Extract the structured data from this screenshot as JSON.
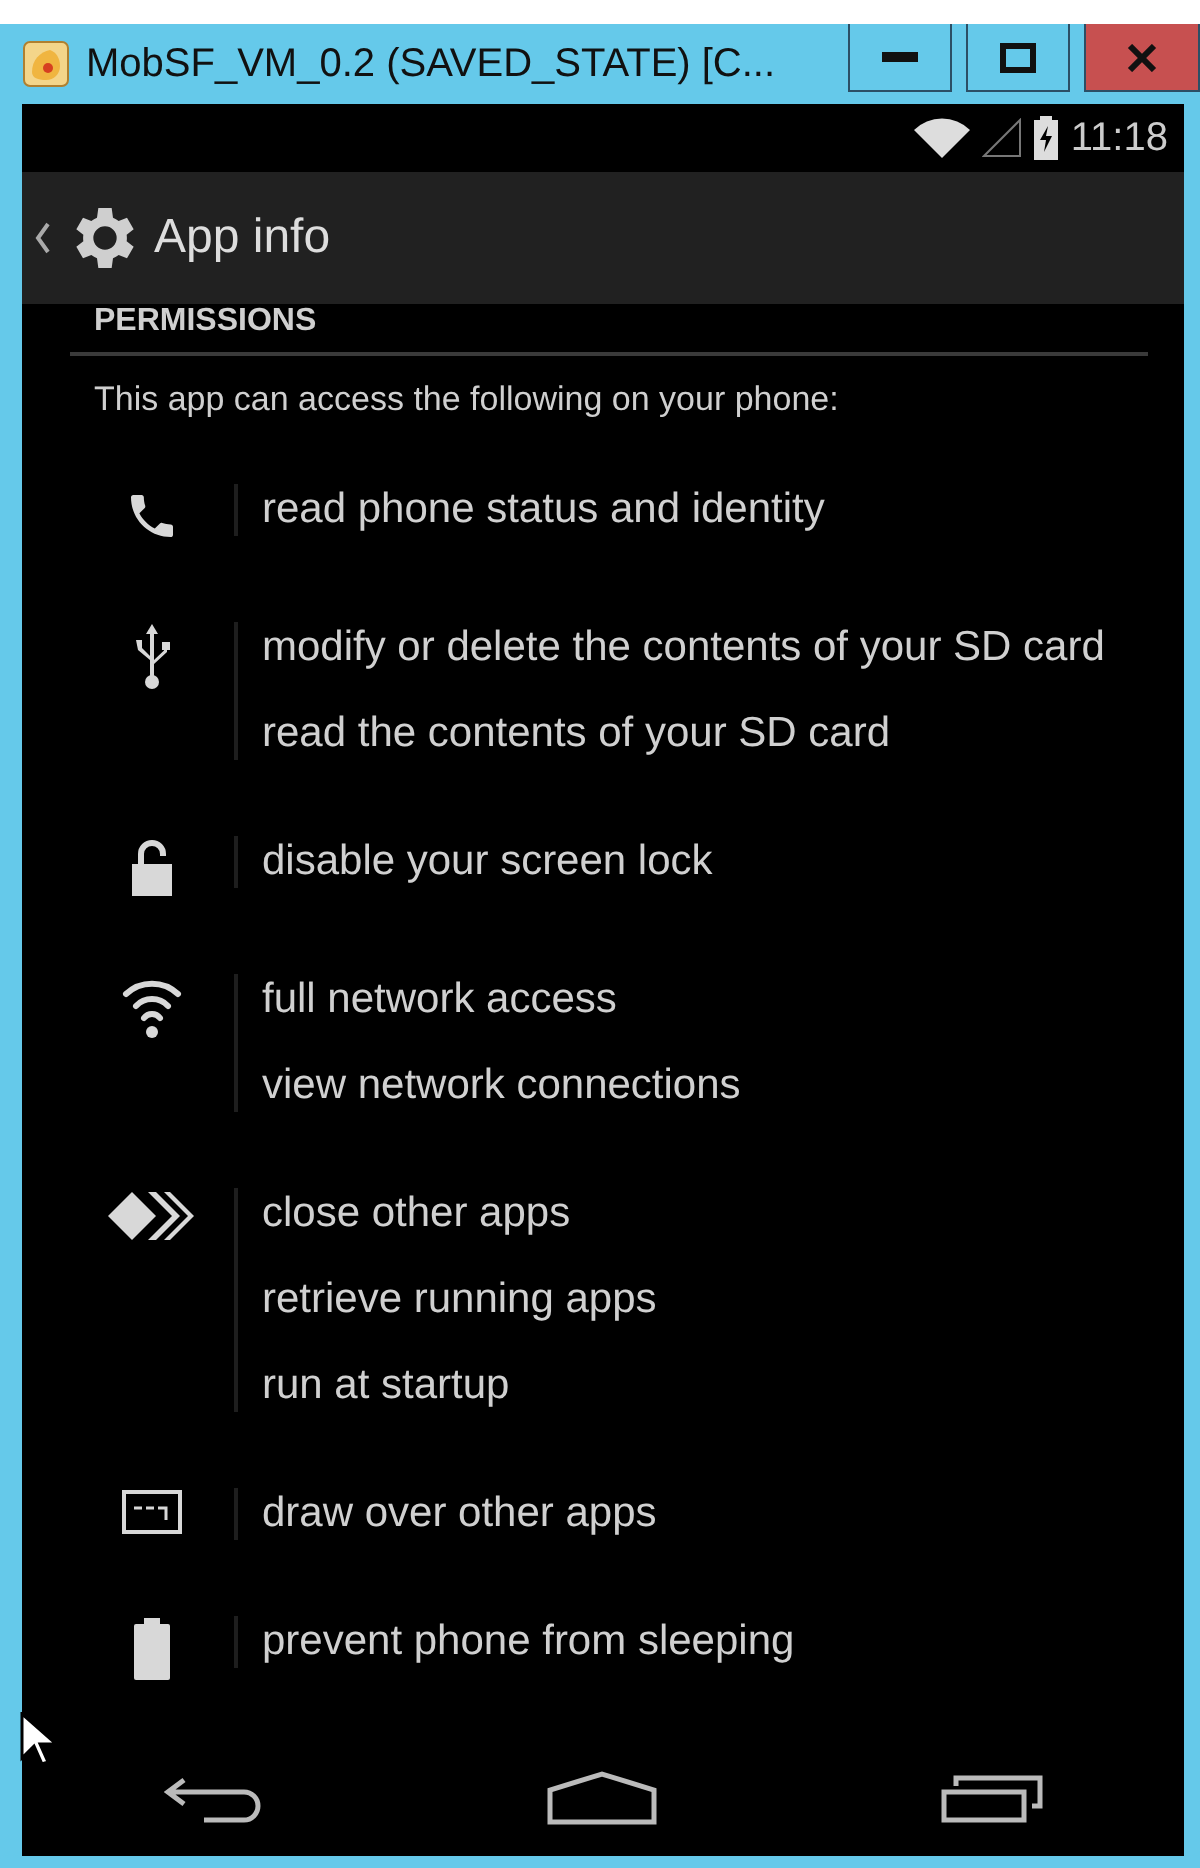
{
  "window": {
    "title": "MobSF_VM_0.2 (SAVED_STATE) [C..."
  },
  "status_bar": {
    "time": "11:18"
  },
  "action_bar": {
    "title": "App info"
  },
  "section": {
    "heading": "PERMISSIONS",
    "intro": "This app can access the following on your phone:"
  },
  "permission_groups": [
    {
      "kind": "phone",
      "items": [
        "read phone status and identity"
      ]
    },
    {
      "kind": "usb",
      "items": [
        "modify or delete the contents of your SD card",
        "read the contents of your SD card"
      ]
    },
    {
      "kind": "lock",
      "items": [
        "disable your screen lock"
      ]
    },
    {
      "kind": "wifi",
      "items": [
        "full network access",
        "view network connections"
      ]
    },
    {
      "kind": "apps",
      "items": [
        "close other apps",
        "retrieve running apps",
        "run at startup"
      ]
    },
    {
      "kind": "overlay",
      "items": [
        "draw over other apps"
      ]
    },
    {
      "kind": "battery",
      "items": [
        "prevent phone from sleeping"
      ]
    }
  ]
}
